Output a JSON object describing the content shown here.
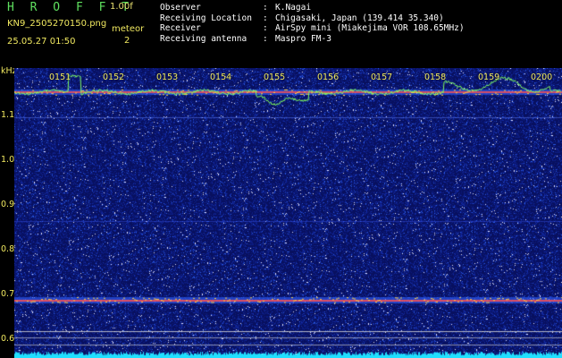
{
  "header": {
    "title": "H R O F F T",
    "version": "1.00f",
    "filename": "KN9_2505270150.png",
    "timestamp": "25.05.27 01:50",
    "meteor_label": "meteor",
    "meteor_count": "2"
  },
  "info": [
    {
      "key": "Observer",
      "sep": ":",
      "value": "K.Nagai"
    },
    {
      "key": "Receiving Location",
      "sep": ":",
      "value": "Chigasaki, Japan (139.414 35.340)"
    },
    {
      "key": "Receiver",
      "sep": ":",
      "value": "AirSpy mini (Miakejima VOR 108.65MHz)"
    },
    {
      "key": "Receiving antenna",
      "sep": ":",
      "value": "Maspro FM-3"
    }
  ],
  "y_axis": {
    "unit": "kHz",
    "ticks": [
      "1.1",
      "1.0",
      "0.9",
      "0.8",
      "0.7",
      "0.6"
    ]
  },
  "time_marks": [
    "0151",
    "0152",
    "0153",
    "0154",
    "0155",
    "0156",
    "0157",
    "0158",
    "0159",
    "0200"
  ],
  "colors": {
    "background_noise": "#0b1570",
    "label_yellow": "#f0e860",
    "title_green": "#5fe05f",
    "signal_line": "#ff5050",
    "trace_green": "#80ff60",
    "baseline_cyan": "#20e0ff"
  }
}
